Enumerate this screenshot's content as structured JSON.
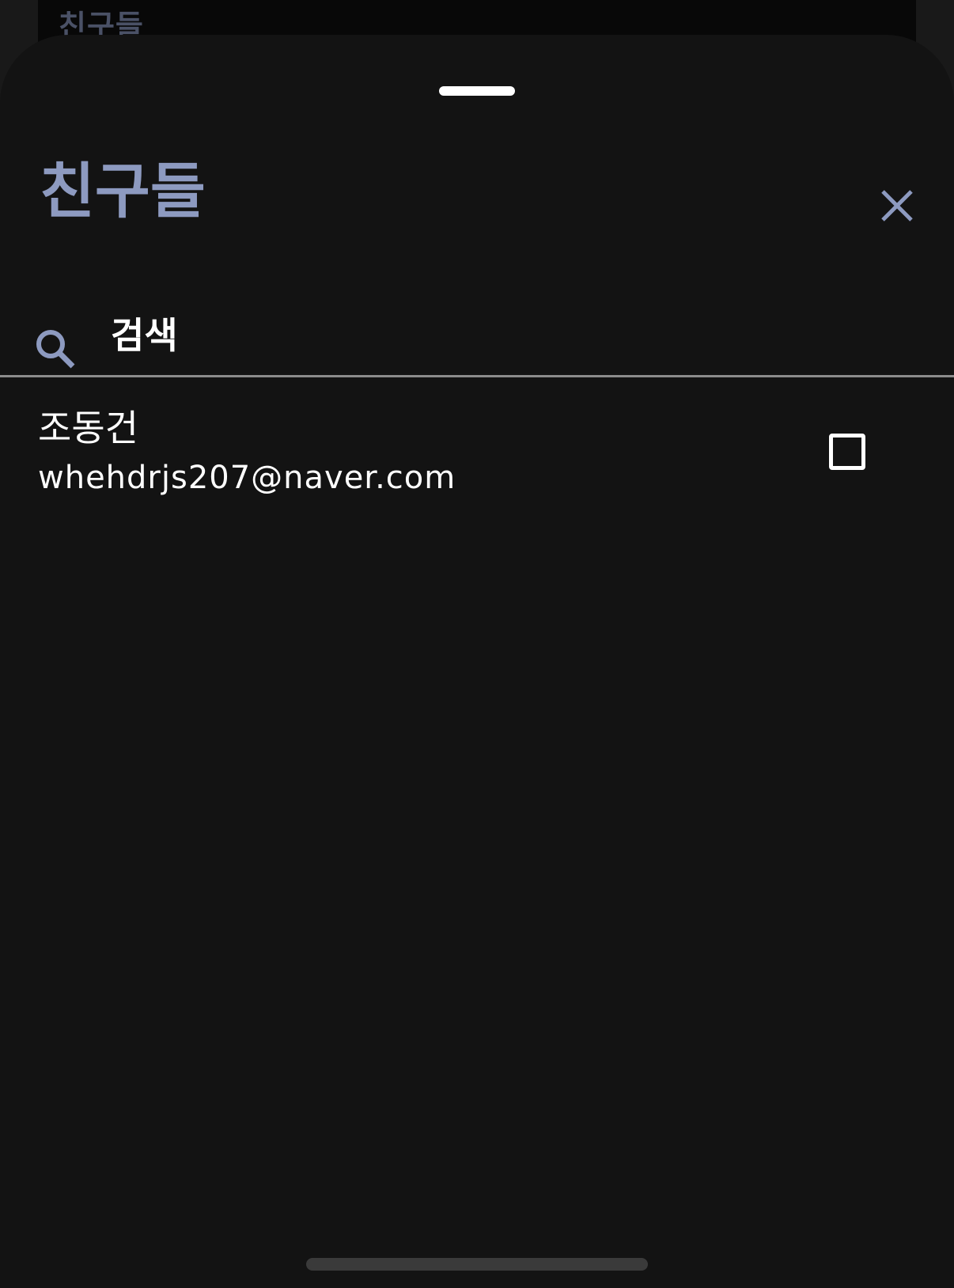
{
  "background_screen": {
    "title": "친구들"
  },
  "sheet": {
    "title": "친구들",
    "close_icon": "close-icon",
    "accent_color": "#8d9ac0",
    "background_color": "#131313"
  },
  "search": {
    "icon": "search-icon",
    "placeholder": "검색",
    "value": ""
  },
  "friends": [
    {
      "name": "조동건",
      "email": "whehdrjs207@naver.com",
      "checked": false
    }
  ]
}
